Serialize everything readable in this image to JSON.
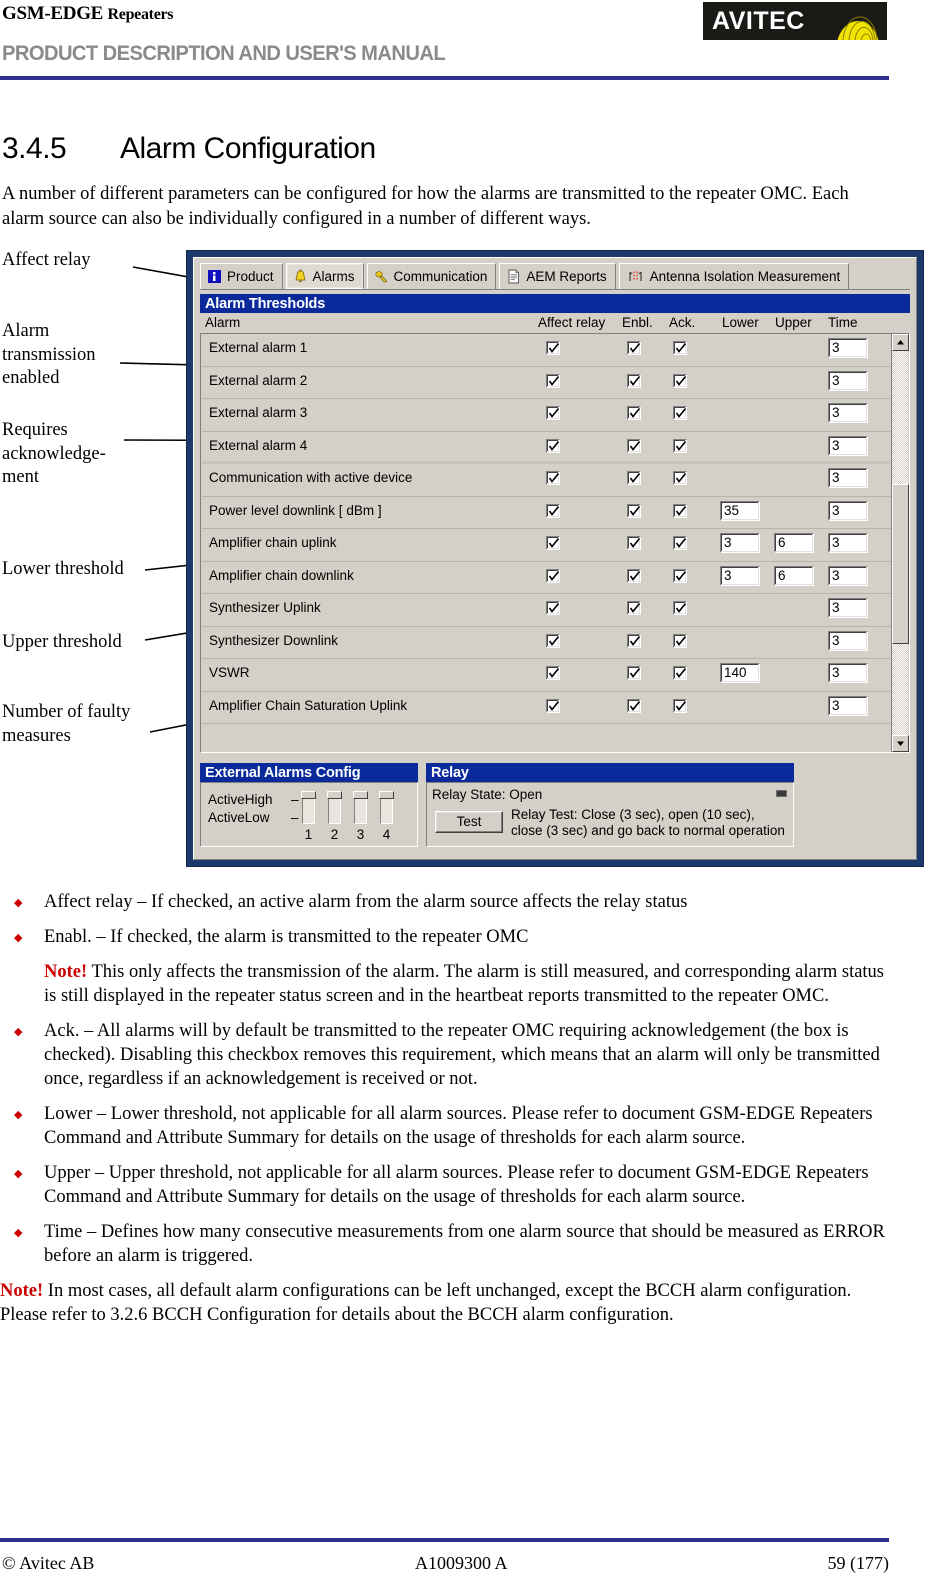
{
  "header": {
    "doc_type_main": "GSM-EDGE",
    "doc_type_sub": "Repeaters",
    "title": "PRODUCT DESCRIPTION AND USER'S MANUAL",
    "logo_text": "AVITEC"
  },
  "section": {
    "number": "3.4.5",
    "title": "Alarm Configuration",
    "intro": "A number of different parameters can be configured for how the alarms are transmitted to the repeater OMC. Each alarm source can also be individually configured in a number of different ways."
  },
  "annotations": {
    "affect_relay": "Affect relay",
    "alarm_transmission_enabled": "Alarm transmission enabled",
    "requires_acknowledgement": "Requires acknowledge-ment",
    "lower_threshold": "Lower threshold",
    "upper_threshold": "Upper threshold",
    "number_of_faulty_measures": "Number of faulty measures"
  },
  "app": {
    "tabs": [
      {
        "label": "Product",
        "icon": "info-icon",
        "selected": false
      },
      {
        "label": "Alarms",
        "icon": "bell-icon",
        "selected": true
      },
      {
        "label": "Communication",
        "icon": "phone-icon",
        "selected": false
      },
      {
        "label": "AEM Reports",
        "icon": "document-icon",
        "selected": false
      },
      {
        "label": "Antenna Isolation Measurement",
        "icon": "antenna-icon",
        "selected": false
      }
    ],
    "grid_title": "Alarm Thresholds",
    "columns": {
      "alarm": "Alarm",
      "affect_relay": "Affect relay",
      "enbl": "Enbl.",
      "ack": "Ack.",
      "lower": "Lower",
      "upper": "Upper",
      "time": "Time"
    },
    "rows": [
      {
        "name": "External alarm 1",
        "affect_relay": true,
        "enbl": true,
        "ack": true,
        "lower": "",
        "upper": "",
        "time": "3",
        "group_end": false
      },
      {
        "name": "External alarm 2",
        "affect_relay": true,
        "enbl": true,
        "ack": true,
        "lower": "",
        "upper": "",
        "time": "3",
        "group_end": false
      },
      {
        "name": "External alarm 3",
        "affect_relay": true,
        "enbl": true,
        "ack": true,
        "lower": "",
        "upper": "",
        "time": "3",
        "group_end": false
      },
      {
        "name": "External alarm 4",
        "affect_relay": true,
        "enbl": true,
        "ack": true,
        "lower": "",
        "upper": "",
        "time": "3",
        "group_end": true
      },
      {
        "name": "Communication with active device",
        "affect_relay": true,
        "enbl": true,
        "ack": true,
        "lower": "",
        "upper": "",
        "time": "3",
        "group_end": false
      },
      {
        "name": "Power level downlink  [ dBm ]",
        "affect_relay": true,
        "enbl": true,
        "ack": true,
        "lower": "35",
        "upper": "",
        "time": "3",
        "group_end": false
      },
      {
        "name": "Amplifier chain uplink",
        "affect_relay": true,
        "enbl": true,
        "ack": true,
        "lower": "3",
        "upper": "6",
        "time": "3",
        "group_end": false
      },
      {
        "name": "Amplifier chain downlink",
        "affect_relay": true,
        "enbl": true,
        "ack": true,
        "lower": "3",
        "upper": "6",
        "time": "3",
        "group_end": false
      },
      {
        "name": "Synthesizer Uplink",
        "affect_relay": true,
        "enbl": true,
        "ack": true,
        "lower": "",
        "upper": "",
        "time": "3",
        "group_end": false
      },
      {
        "name": "Synthesizer Downlink",
        "affect_relay": true,
        "enbl": true,
        "ack": true,
        "lower": "",
        "upper": "",
        "time": "3",
        "group_end": false
      },
      {
        "name": "VSWR",
        "affect_relay": true,
        "enbl": true,
        "ack": true,
        "lower": "140",
        "upper": "",
        "time": "3",
        "group_end": false
      },
      {
        "name": "Amplifier Chain Saturation Uplink",
        "affect_relay": true,
        "enbl": true,
        "ack": true,
        "lower": "",
        "upper": "",
        "time": "3",
        "group_end": false
      }
    ],
    "external_alarms_config": {
      "title": "External Alarms Config",
      "active_high_label": "ActiveHigh",
      "active_low_label": "ActiveLow",
      "switches": [
        {
          "number": "1",
          "position": "high"
        },
        {
          "number": "2",
          "position": "high"
        },
        {
          "number": "3",
          "position": "high"
        },
        {
          "number": "4",
          "position": "high"
        }
      ]
    },
    "relay": {
      "title": "Relay",
      "state_label": "Relay State: Open",
      "test_button": "Test",
      "description": "Relay Test: Close (3 sec), open (10 sec), close (3 sec) and go back to normal operation"
    }
  },
  "bullets": [
    "Affect relay – If checked, an active alarm from the alarm source affects the relay status",
    "Enabl. – If checked, the alarm is transmitted to the repeater OMC",
    "Ack. – All alarms will by default be transmitted to the repeater OMC requiring acknowledgement (the box is checked). Disabling this checkbox removes this requirement, which means that an alarm will only be transmitted once, regardless if an acknowledgement is received or not.",
    "Lower – Lower threshold, not applicable for all alarm sources. Please refer to document GSM-EDGE Repeaters Command and Attribute Summary for details on the usage of thresholds for each alarm source.",
    "Upper – Upper threshold, not applicable for all alarm sources. Please refer to document GSM-EDGE Repeaters Command and Attribute Summary for details on the usage of thresholds for each alarm source.",
    "Time – Defines how many consecutive measurements from one alarm source that should be measured as ERROR before an alarm is triggered."
  ],
  "notes": {
    "keyword": "Note!",
    "note1_body": " This only affects the transmission of the alarm. The alarm is still measured, and corresponding alarm status is still displayed in the repeater status screen and in the heartbeat reports transmitted to the repeater OMC.",
    "note2_body": " In most cases, all default alarm configurations can be left unchanged, except the BCCH alarm configuration. Please refer to 3.2.6 BCCH Configuration for details about the BCCH alarm configuration."
  },
  "footer": {
    "left": "© Avitec AB",
    "middle": "A1009300 A",
    "right": "59 (177)"
  }
}
